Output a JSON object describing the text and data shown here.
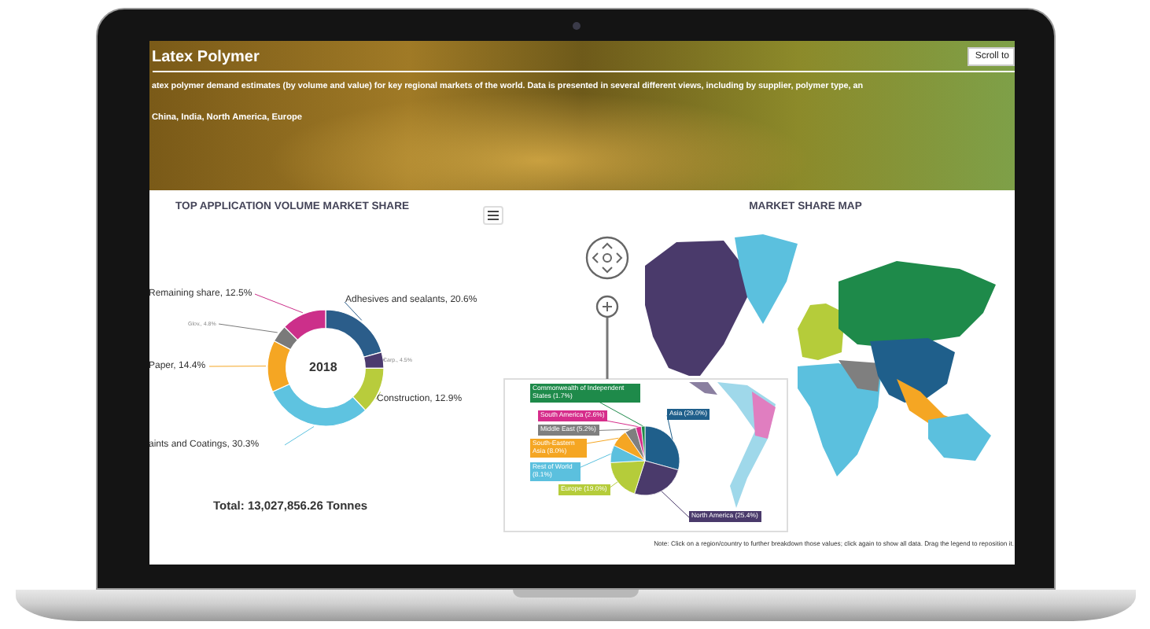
{
  "header": {
    "title": "Latex Polymer",
    "scroll_button": "Scroll to",
    "description": "atex polymer demand estimates (by volume and value) for key regional markets of the world. Data is presented in several different views, including by supplier, polymer type, an",
    "regions": "China, India, North America, Europe"
  },
  "application_chart": {
    "title": "TOP APPLICATION VOLUME MARKET SHARE",
    "center_label": "2018",
    "total": "Total: 13,027,856.26 Tonnes",
    "chart_data": {
      "type": "donut",
      "categories": [
        "Adhesives and sealants, 20.6%",
        "Carp., 4.5%",
        "Construction, 12.9%",
        "aints and Coatings, 30.3%",
        "Paper, 14.4%",
        "Glov., 4.8%",
        "Remaining share, 12.5%"
      ],
      "values": [
        20.6,
        4.5,
        12.9,
        30.3,
        14.4,
        4.8,
        12.5
      ]
    }
  },
  "map_panel": {
    "title": "MARKET SHARE MAP",
    "chart_data": {
      "type": "pie",
      "categories": [
        "Asia (29.0%)",
        "North America (25.4%)",
        "Europe (19.0%)",
        "Rest of World (8.1%)",
        "South-Eastern Asia (8.0%)",
        "Middle East (5.2%)",
        "South America (2.6%)",
        "Commonwealth of Independent States (1.7%)"
      ],
      "values": [
        29.0,
        25.4,
        19.0,
        8.1,
        8.0,
        5.2,
        2.6,
        1.7
      ]
    },
    "note": "Note: Click on a region/country to further breakdown those values; click again to show all data. Drag the legend to reposition it."
  }
}
